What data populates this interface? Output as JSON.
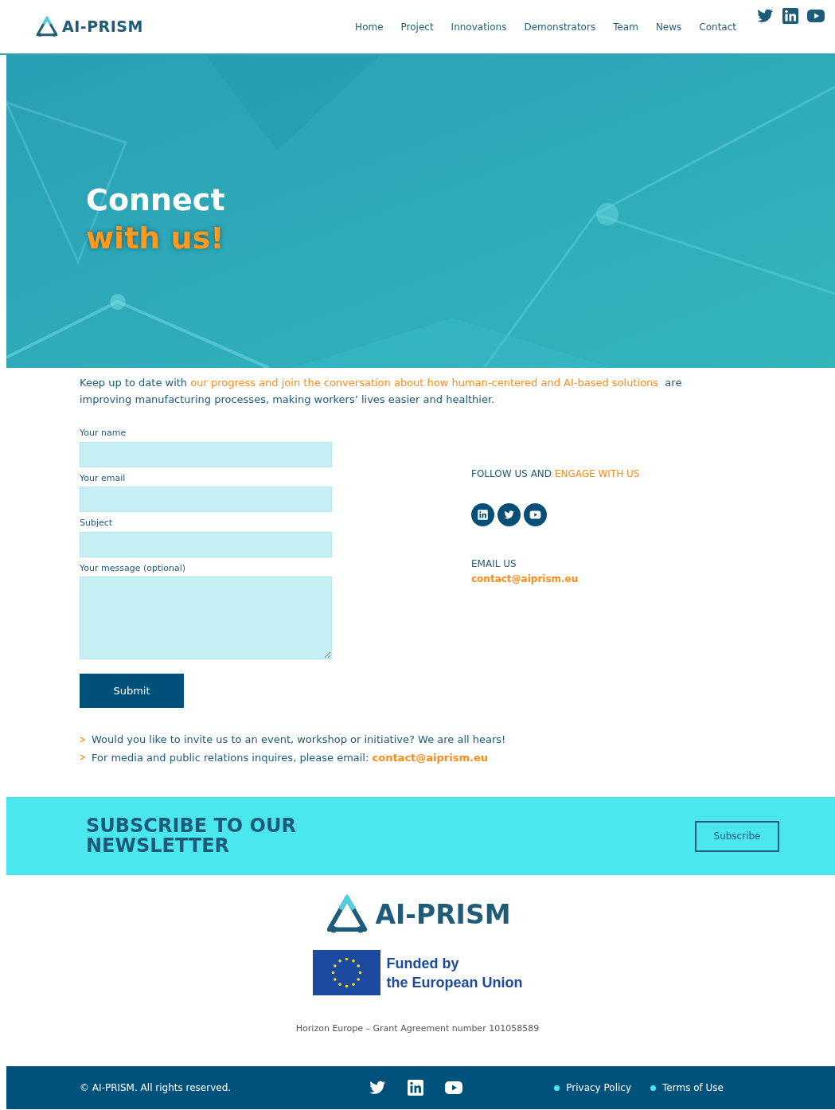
{
  "header": {
    "logo": "AI-PRISM",
    "nav": [
      {
        "label": "Home"
      },
      {
        "label": "Project"
      },
      {
        "label": "Innovations"
      },
      {
        "label": "Demonstrators"
      },
      {
        "label": "Team"
      },
      {
        "label": "News"
      },
      {
        "label": "Contact"
      }
    ],
    "social": [
      {
        "kind": "twitter"
      },
      {
        "kind": "linkedin"
      },
      {
        "kind": "youtube"
      }
    ]
  },
  "hero": {
    "title_line_1": "Connect",
    "title_line_2": "with us!"
  },
  "intro": [
    {
      "text": "Keep up to date with ",
      "accent": false
    },
    {
      "text": "our progress and join the conversation about how human-centered and AI-based solutions",
      "accent": true
    },
    {
      "text": "  are improving manufacturing processes, making workers’ lives easier and healthier.",
      "accent": false
    }
  ],
  "form": {
    "fields": [
      {
        "label": "Your name",
        "kind": "input"
      },
      {
        "label": "Your email",
        "kind": "input"
      },
      {
        "label": "Subject",
        "kind": "input"
      },
      {
        "label": "Your message (optional)",
        "kind": "textarea"
      }
    ],
    "submit": "Submit"
  },
  "follow": {
    "heading": [
      {
        "text": "FOLLOW US AND ",
        "accent": false
      },
      {
        "text": "ENGAGE WITH US",
        "accent": true
      }
    ],
    "social": [
      {
        "kind": "linkedin"
      },
      {
        "kind": "twitter"
      },
      {
        "kind": "youtube"
      }
    ]
  },
  "email": {
    "label": "EMAIL US",
    "address": "contact@aiprism.eu"
  },
  "notes": [
    {
      "text": "Would you like to invite us to an event, workshop or initiative? We are all hears!"
    },
    {
      "text": "For media and public relations inquires, please email: ",
      "link": "contact@aiprism.eu"
    }
  ],
  "newsletter": {
    "title": "SUBSCRIBE TO OUR NEWSLETTER",
    "button": "Subscribe"
  },
  "footer": {
    "logo": "AI-PRISM",
    "funded_line_1": "Funded by",
    "funded_line_2": "the European Union",
    "grant": "Horizon Europe – Grant Agreement number 101058589"
  },
  "bottom_bar": {
    "copyright": "© AI-PRISM. All rights reserved.",
    "social": [
      {
        "kind": "twitter"
      },
      {
        "kind": "linkedin"
      },
      {
        "kind": "youtube"
      }
    ],
    "links": [
      "Privacy Policy",
      "Terms of Use"
    ]
  }
}
